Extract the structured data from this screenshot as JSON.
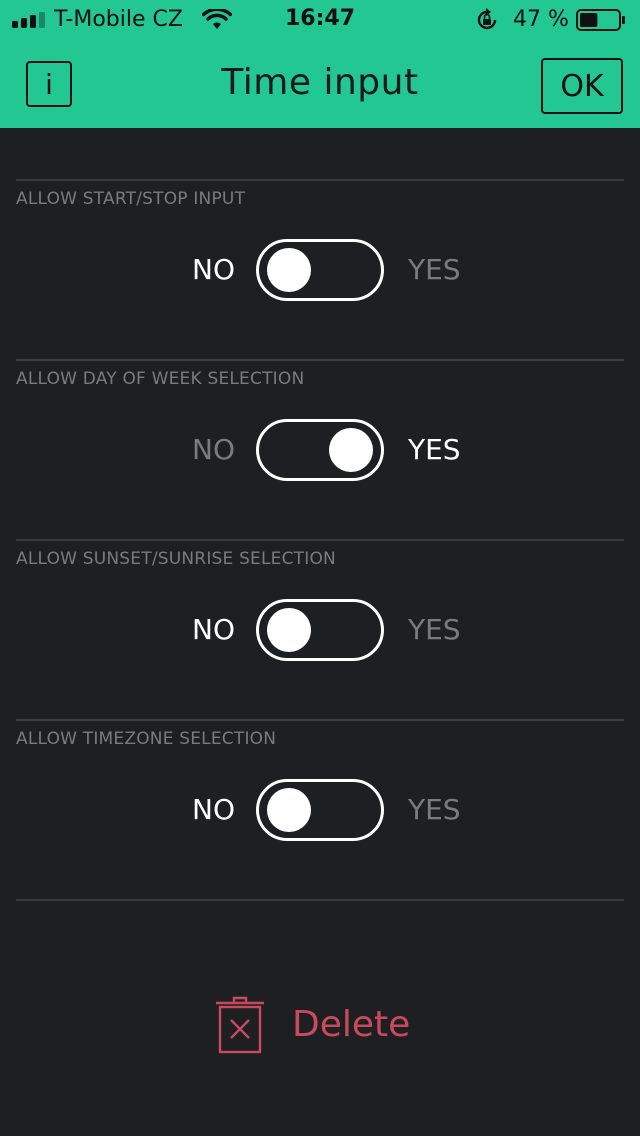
{
  "status_bar": {
    "carrier": "T-Mobile CZ",
    "time": "16:47",
    "battery": "47 %",
    "battery_level": 0.47,
    "signal_bars": 3,
    "icons": [
      "signal-icon",
      "wifi-icon",
      "rotation-lock-icon",
      "battery-icon"
    ]
  },
  "header": {
    "info_label": "i",
    "title": "Time input",
    "ok_label": "OK",
    "background": "#22c791"
  },
  "settings": [
    {
      "label": "ALLOW START/STOP INPUT",
      "no": "NO",
      "yes": "YES",
      "value": false
    },
    {
      "label": "ALLOW DAY OF WEEK SELECTION",
      "no": "NO",
      "yes": "YES",
      "value": true
    },
    {
      "label": "ALLOW SUNSET/SUNRISE SELECTION",
      "no": "NO",
      "yes": "YES",
      "value": false
    },
    {
      "label": "ALLOW TIMEZONE SELECTION",
      "no": "NO",
      "yes": "YES",
      "value": false
    }
  ],
  "delete": {
    "label": "Delete",
    "icon": "trash-icon",
    "color": "#c94a5d"
  }
}
